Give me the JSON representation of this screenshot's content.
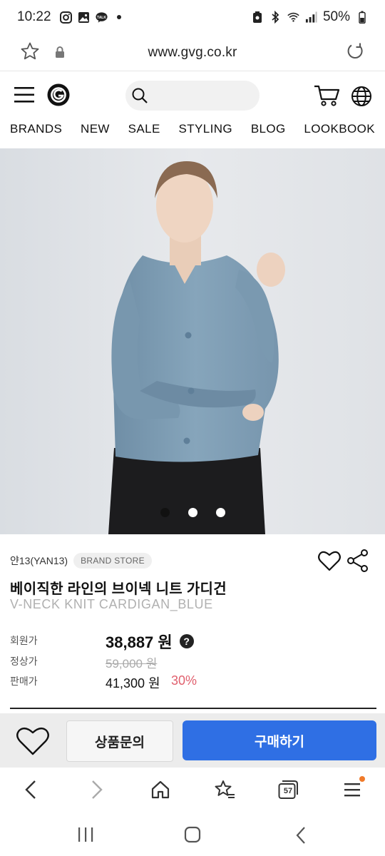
{
  "status_bar": {
    "time": "10:22",
    "battery": "50%",
    "notif_icons": [
      "instagram-icon",
      "gallery-icon",
      "kakaotalk-icon",
      "dot-icon"
    ],
    "notif_kakao_label": "TALK",
    "system_icons": [
      "battery-saver-icon",
      "bluetooth-icon",
      "wifi-icon",
      "signal-icon",
      "battery-icon"
    ]
  },
  "browser": {
    "url": "www.gvg.co.kr"
  },
  "nav": {
    "items": [
      "BRANDS",
      "NEW",
      "SALE",
      "STYLING",
      "BLOG",
      "LOOKBOOK"
    ]
  },
  "carousel": {
    "total_slides": 3,
    "active_index": 0
  },
  "product": {
    "brand": "얀13(YAN13)",
    "brand_badge": "BRAND STORE",
    "title_ko": "베이직한 라인의 브이넥 니트 가디건",
    "title_en": "V-NECK KNIT CARDIGAN_BLUE",
    "member_price_label": "회원가",
    "member_price": "38,887 원",
    "help_symbol": "?",
    "regular_price_label": "정상가",
    "regular_price": "59,000 원",
    "sale_price_label": "판매가",
    "sale_price": "41,300 원",
    "discount": "30%"
  },
  "actions": {
    "inquiry": "상품문의",
    "buy": "구매하기"
  },
  "browser_toolbar": {
    "tabs_count": "57"
  },
  "colors": {
    "buy_button": "#2f6fe4",
    "discount": "#e0606e",
    "cardigan": "#7f9fb6",
    "menu_badge": "#f07a2a"
  }
}
